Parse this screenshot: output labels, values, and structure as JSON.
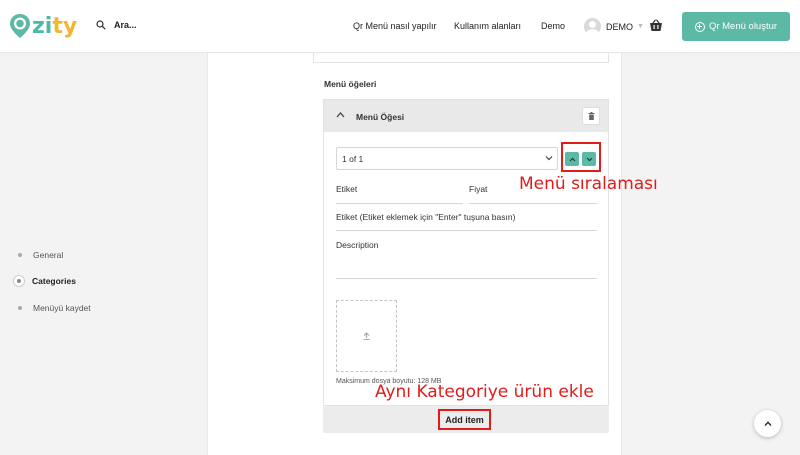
{
  "brand": {
    "name_part1": "zi",
    "name_part2": "ty",
    "accent": "#5cb9a6",
    "accent_yellow": "#f2b631"
  },
  "header": {
    "search_label": "Ara...",
    "nav": [
      "Qr Menü nasıl yapılır",
      "Kullanım alanları",
      "Demo"
    ],
    "user_label": "DEMO",
    "cta_label": "Qr Menü oluştur"
  },
  "sidebar": {
    "items": [
      {
        "label": "General",
        "active": false
      },
      {
        "label": "Categories",
        "active": true
      },
      {
        "label": "Menüyü kaydet",
        "active": false
      }
    ]
  },
  "form": {
    "section_title": "Menü öğeleri",
    "item_title": "Menü Öğesi",
    "order_select_value": "1 of 1",
    "label_field": "Etiket",
    "price_field": "Fiyat",
    "tags_field": "Etiket (Etiket eklemek için \"Enter\" tuşuna basın)",
    "description_field": "Description",
    "max_size_text": "Maksimum dosya boyutu: 128 MB",
    "add_item_label": "Add item"
  },
  "annotations": {
    "order_note": "Menü sıralaması",
    "add_note": "Aynı Kategoriye ürün ekle",
    "color": "#e21b1b"
  }
}
